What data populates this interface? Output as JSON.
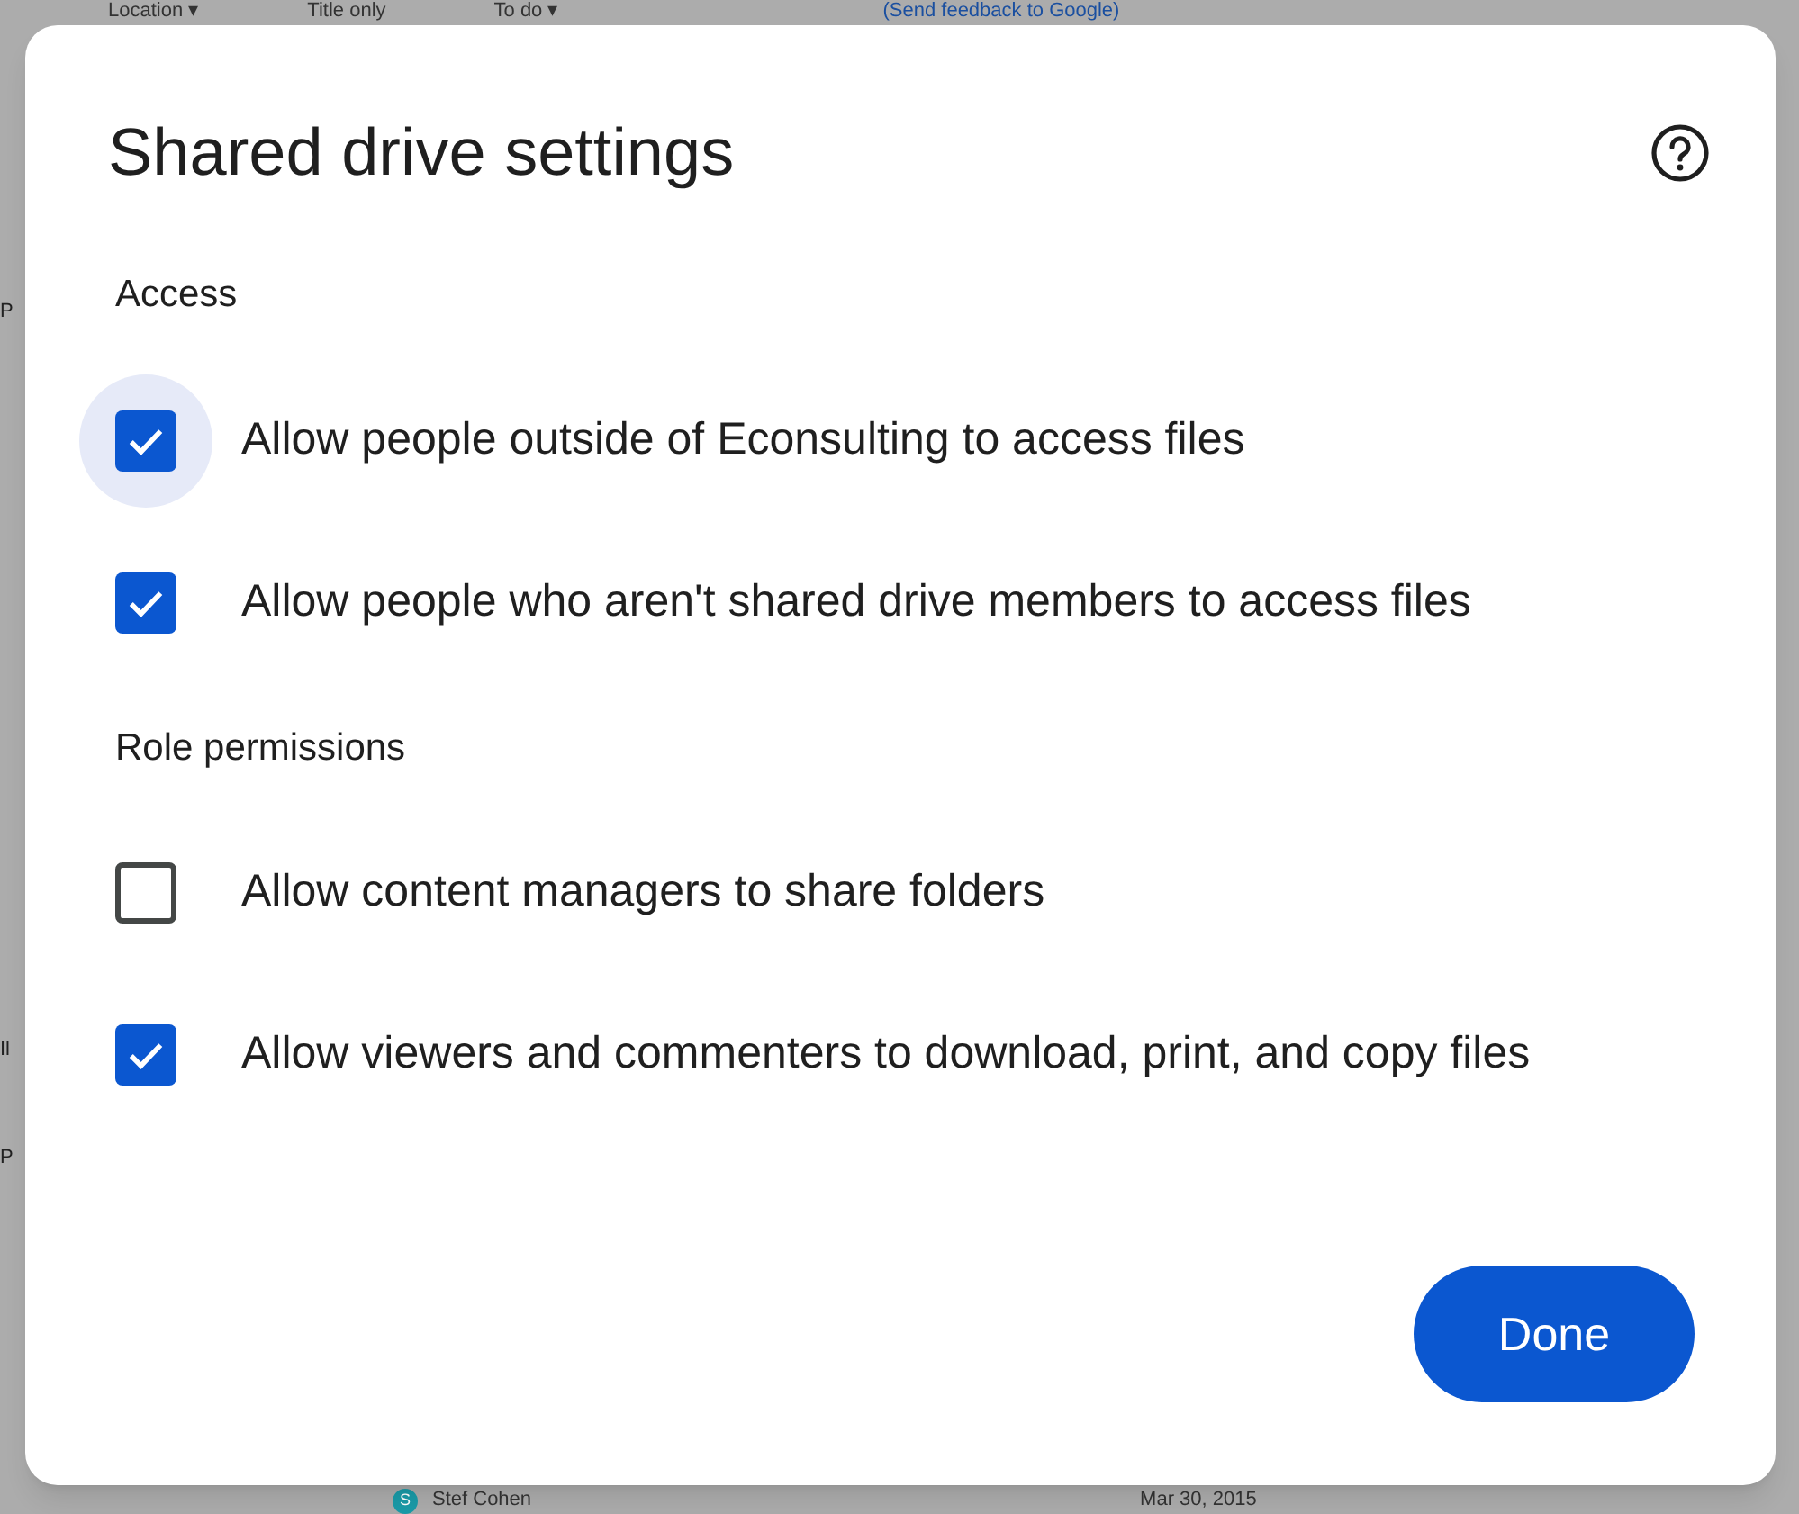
{
  "background": {
    "toolbar": [
      "Location ▾",
      "Title only",
      "To do ▾"
    ],
    "feedback_link": "(Send feedback to Google)",
    "side_fragments": [
      "P",
      "Il",
      "P"
    ],
    "row": {
      "avatar": "S",
      "name": "Stef Cohen",
      "date": "Mar 30, 2015"
    }
  },
  "dialog": {
    "title": "Shared drive settings",
    "sections": [
      {
        "heading": "Access",
        "items": [
          {
            "label": "Allow people outside of Econsulting to access files",
            "checked": true,
            "focused": true
          },
          {
            "label": "Allow people who aren't shared drive members to access files",
            "checked": true,
            "focused": false
          }
        ]
      },
      {
        "heading": "Role permissions",
        "items": [
          {
            "label": "Allow content managers to share folders",
            "checked": false,
            "focused": false
          },
          {
            "label": "Allow viewers and commenters to download, print, and copy files",
            "checked": true,
            "focused": false
          }
        ]
      }
    ],
    "button": "Done"
  }
}
